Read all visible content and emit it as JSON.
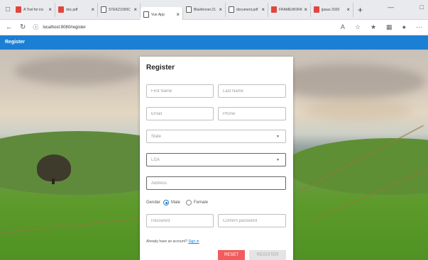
{
  "browser": {
    "tabs": [
      {
        "label": "A Tool for inc",
        "icon": "pdf-icon",
        "active": false
      },
      {
        "label": "doc.pdf",
        "icon": "pdf-icon",
        "active": false
      },
      {
        "label": "STEKZ1000C",
        "icon": "doc-icon",
        "active": false
      },
      {
        "label": "Vue App",
        "icon": "doc-icon",
        "active": true
      },
      {
        "label": "Bluefenner.21",
        "icon": "doc-icon",
        "active": false
      },
      {
        "label": "document.pdf",
        "icon": "doc-icon",
        "active": false
      },
      {
        "label": "FRAMEWORK",
        "icon": "pdf-icon",
        "active": false
      },
      {
        "label": "jjasus 2020",
        "icon": "pdf-icon",
        "active": false
      }
    ],
    "url": "localhost:8080/register"
  },
  "app": {
    "header_title": "Register"
  },
  "form": {
    "title": "Register",
    "first_name_placeholder": "First Name",
    "last_name_placeholder": "Last Name",
    "email_placeholder": "Email",
    "phone_placeholder": "Phone",
    "state_placeholder": "State",
    "lga_placeholder": "LGA",
    "address_placeholder": "Address",
    "gender_label": "Gender",
    "gender_male": "Male",
    "gender_female": "Female",
    "password_placeholder": "Password",
    "confirm_password_placeholder": "Confirm password",
    "account_prompt": "Already have an account?",
    "sign_in_link": "Sign in",
    "reset_label": "RESET",
    "register_label": "REGISTER"
  },
  "colors": {
    "app_header": "#1b7fd3",
    "reset_button": "#f25c5c",
    "register_button_disabled": "#e4e4e4"
  }
}
